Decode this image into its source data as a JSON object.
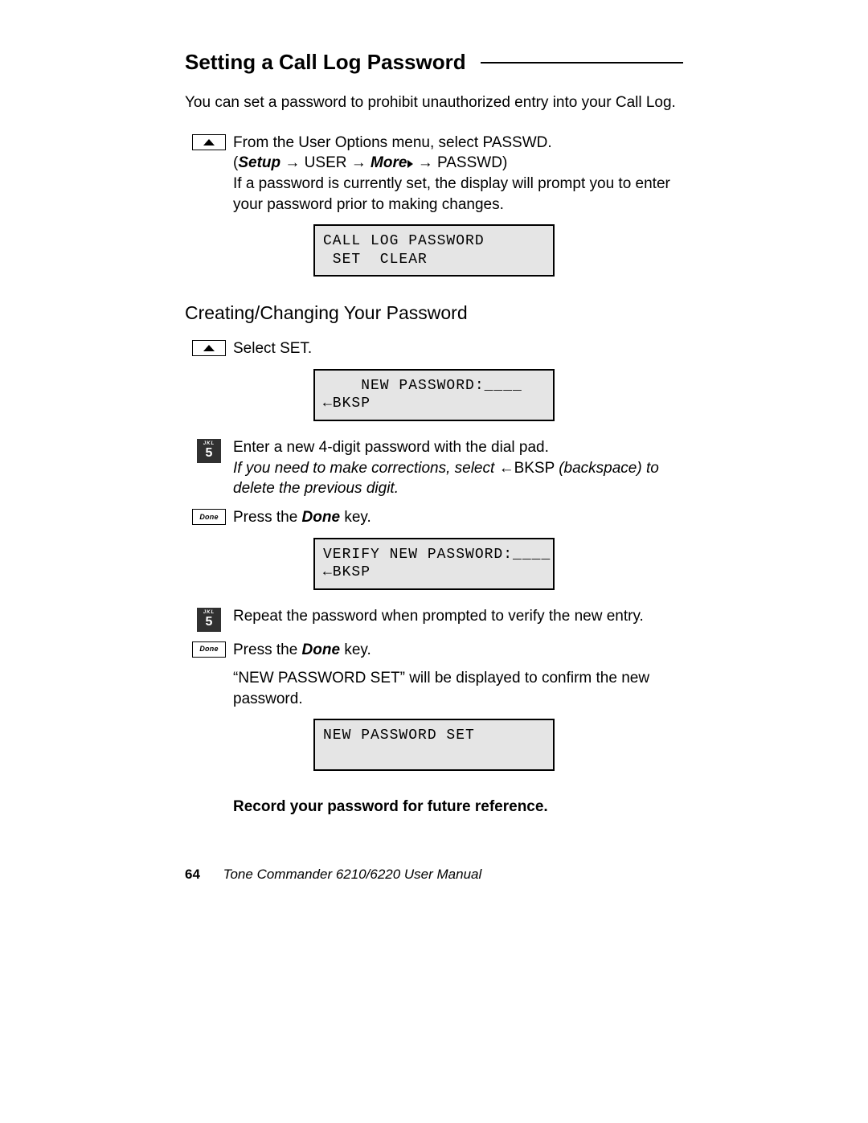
{
  "heading": "Setting a Call Log Password",
  "intro": "You can set a password to prohibit unauthorized entry into your Call Log.",
  "step1": {
    "line1": "From the User Options menu, select PASSWD.",
    "path_setup": "Setup",
    "path_user": "USER",
    "path_more": "More",
    "path_passwd": "PASSWD",
    "line2": "If a password is currently set, the display will prompt you to enter your password prior to making changes."
  },
  "lcd1": "CALL LOG PASSWORD\n SET  CLEAR",
  "subheading": "Creating/Changing Your Password",
  "step2": "Select SET.",
  "lcd2": "    NEW PASSWORD:____\n←BKSP",
  "step3": {
    "line1": "Enter a new 4-digit password with the dial pad.",
    "line2a": "If you need to make corrections, select ",
    "line2b": "BKSP ",
    "line2c": "(backspace) to delete the previous digit."
  },
  "step4a": "Press the ",
  "step4b": "Done",
  "step4c": " key.",
  "lcd3": "VERIFY NEW PASSWORD:____\n←BKSP",
  "step5": "Repeat the password when prompted to verify the new entry.",
  "step6a": "Press the ",
  "step6b": "Done",
  "step6c": " key.",
  "step7": " “NEW PASSWORD SET” will be displayed to confirm the new password.",
  "lcd4": "NEW PASSWORD SET\n ",
  "note": "Record your password for future reference.",
  "footer_page": "64",
  "footer_title": "Tone Commander 6210/6220 User Manual",
  "icons": {
    "done_label": "Done",
    "key5_letters": "JKL",
    "key5_digit": "5"
  }
}
